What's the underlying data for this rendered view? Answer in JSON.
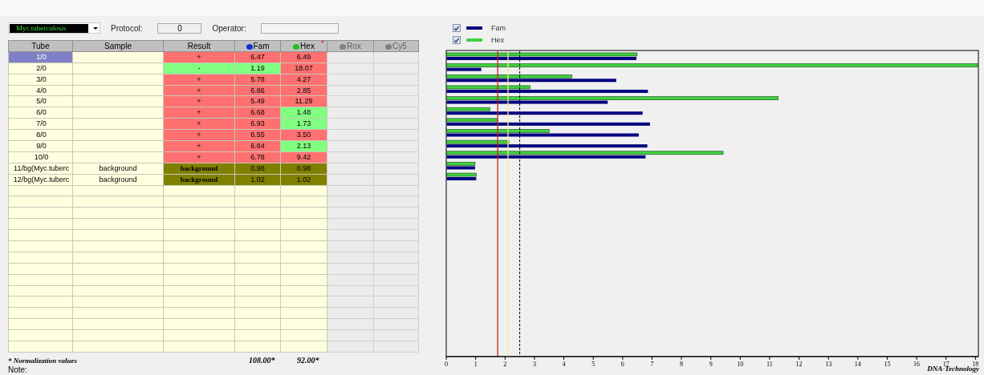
{
  "assay": {
    "value": "Myc.tuberculosis"
  },
  "protocol": {
    "label": "Protocol:",
    "value": "0"
  },
  "operator": {
    "label": "Operator:"
  },
  "table": {
    "columns": [
      {
        "label": "Tube",
        "kind": "text"
      },
      {
        "label": "Sample",
        "kind": "text"
      },
      {
        "label": "Result",
        "kind": "text"
      },
      {
        "label": "Fam",
        "kind": "channel",
        "color": "#1030d0",
        "disabled": false
      },
      {
        "label": "Hex",
        "kind": "channel",
        "color": "#20c020",
        "disabled": false,
        "marker": "*"
      },
      {
        "label": "Rox",
        "kind": "channel",
        "color": "#808080",
        "disabled": true
      },
      {
        "label": "Cy5",
        "kind": "channel",
        "color": "#808080",
        "disabled": true
      }
    ],
    "rows": [
      {
        "tube": "1/0",
        "kind": "sample",
        "selected": true,
        "result": {
          "text": "+",
          "color": "#ff7070"
        },
        "fam": {
          "text": "6.47",
          "color": "#ff7070"
        },
        "hex": {
          "text": "6.49",
          "color": "#ff7070"
        }
      },
      {
        "tube": "2/0",
        "kind": "sample",
        "selected": false,
        "result": {
          "text": "-",
          "color": "#80ff80"
        },
        "fam": {
          "text": "1.19",
          "color": "#80ff80"
        },
        "hex": {
          "text": "18.07",
          "color": "#ff7070"
        }
      },
      {
        "tube": "3/0",
        "kind": "sample",
        "selected": false,
        "result": {
          "text": "+",
          "color": "#ff7070"
        },
        "fam": {
          "text": "5.78",
          "color": "#ff7070"
        },
        "hex": {
          "text": "4.27",
          "color": "#ff7070"
        }
      },
      {
        "tube": "4/0",
        "kind": "sample",
        "selected": false,
        "result": {
          "text": "+",
          "color": "#ff7070"
        },
        "fam": {
          "text": "6.86",
          "color": "#ff7070"
        },
        "hex": {
          "text": "2.85",
          "color": "#ff7070"
        }
      },
      {
        "tube": "5/0",
        "kind": "sample",
        "selected": false,
        "result": {
          "text": "+",
          "color": "#ff7070"
        },
        "fam": {
          "text": "5.49",
          "color": "#ff7070"
        },
        "hex": {
          "text": "11.29",
          "color": "#ff7070"
        }
      },
      {
        "tube": "6/0",
        "kind": "sample",
        "selected": false,
        "result": {
          "text": "+",
          "color": "#ff7070"
        },
        "fam": {
          "text": "6.68",
          "color": "#ff7070"
        },
        "hex": {
          "text": "1.48",
          "color": "#80ff80"
        }
      },
      {
        "tube": "7/0",
        "kind": "sample",
        "selected": false,
        "result": {
          "text": "+",
          "color": "#ff7070"
        },
        "fam": {
          "text": "6.93",
          "color": "#ff7070"
        },
        "hex": {
          "text": "1.73",
          "color": "#80ff80"
        }
      },
      {
        "tube": "8/0",
        "kind": "sample",
        "selected": false,
        "result": {
          "text": "+",
          "color": "#ff7070"
        },
        "fam": {
          "text": "6.55",
          "color": "#ff7070"
        },
        "hex": {
          "text": "3.50",
          "color": "#ff7070"
        }
      },
      {
        "tube": "9/0",
        "kind": "sample",
        "selected": false,
        "result": {
          "text": "+",
          "color": "#ff7070"
        },
        "fam": {
          "text": "6.84",
          "color": "#ff7070"
        },
        "hex": {
          "text": "2.13",
          "color": "#80ff80"
        }
      },
      {
        "tube": "10/0",
        "kind": "sample",
        "selected": false,
        "result": {
          "text": "+",
          "color": "#ff7070"
        },
        "fam": {
          "text": "6.78",
          "color": "#ff7070"
        },
        "hex": {
          "text": "9.42",
          "color": "#ff7070"
        }
      },
      {
        "tube": "11/bg(Myc.tuberc",
        "kind": "background",
        "sample": "background",
        "selected": false,
        "result": {
          "text": "background",
          "color": "#808000"
        },
        "fam": {
          "text": "0.98",
          "color": "#808000"
        },
        "hex": {
          "text": "0.98",
          "color": "#808000"
        }
      },
      {
        "tube": "12/bg(Myc.tuberc",
        "kind": "background",
        "sample": "background",
        "selected": false,
        "result": {
          "text": "background",
          "color": "#808000"
        },
        "fam": {
          "text": "1.02",
          "color": "#808000"
        },
        "hex": {
          "text": "1.02",
          "color": "#808000"
        }
      }
    ]
  },
  "normalization": {
    "label": "* Normalization values",
    "fam": "108.00*",
    "hex": "92.00*"
  },
  "note": {
    "label": "Note:"
  },
  "legend": [
    {
      "checked": true
    },
    {
      "checked": true
    }
  ],
  "chart_data": {
    "type": "bar",
    "orientation": "horizontal",
    "series": [
      {
        "name": "Fam",
        "color": "#000080",
        "values": [
          6.47,
          1.19,
          5.78,
          6.86,
          5.49,
          6.68,
          6.93,
          6.55,
          6.84,
          6.78,
          0.98,
          1.02,
          null,
          null,
          null,
          null,
          null,
          null,
          null,
          null,
          null,
          null,
          null,
          null,
          null,
          null,
          null,
          null
        ]
      },
      {
        "name": "Hex",
        "color": "#40d040",
        "values": [
          6.49,
          18.07,
          4.27,
          2.85,
          11.29,
          1.48,
          1.73,
          3.5,
          2.13,
          9.42,
          0.98,
          1.02,
          null,
          null,
          null,
          null,
          null,
          null,
          null,
          null,
          null,
          null,
          null,
          null,
          null,
          null,
          null,
          null
        ]
      }
    ],
    "xlim": [
      0,
      18.1
    ],
    "xticks": [
      0,
      1,
      2,
      3,
      4,
      5,
      6,
      7,
      8,
      9,
      10,
      11,
      12,
      13,
      14,
      15,
      16,
      17,
      18
    ],
    "ref_lines": [
      {
        "axis": "x",
        "value": 1.75,
        "color": "#c02020"
      },
      {
        "axis": "x",
        "value": 2.1,
        "color": "#f0f080"
      },
      {
        "axis": "x",
        "value": 2.5,
        "color": "#000000"
      }
    ]
  },
  "brand": {
    "text": "DNA-Technology"
  }
}
